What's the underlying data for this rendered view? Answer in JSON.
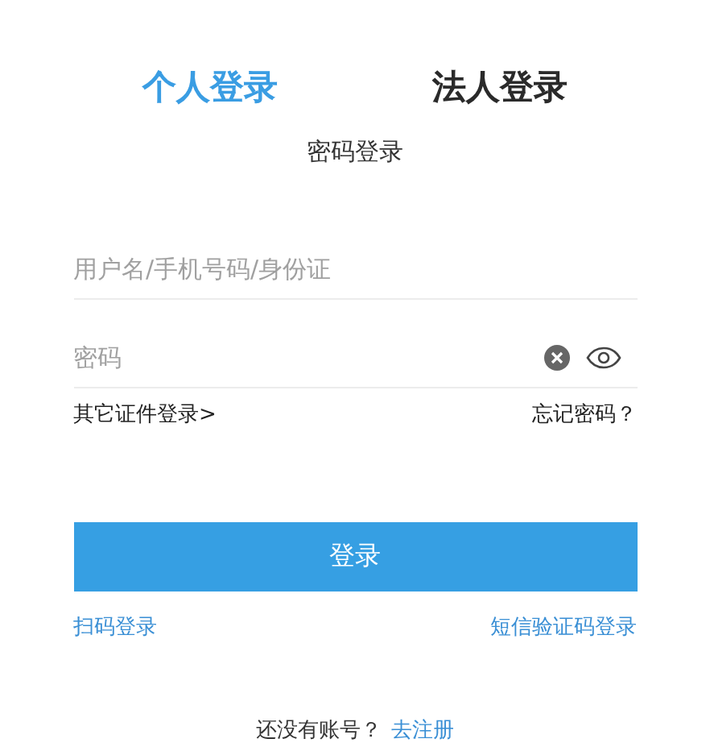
{
  "tabs": [
    {
      "label": "个人登录",
      "selected": true
    },
    {
      "label": "法人登录",
      "selected": false
    }
  ],
  "subtitle": "密码登录",
  "username": {
    "placeholder": "用户名/手机号码/身份证"
  },
  "password": {
    "placeholder": "密码"
  },
  "other_login": "其它证件登录>",
  "forgot": "忘记密码？",
  "login_button": "登录",
  "qr_login": "扫码登录",
  "sms_login": "短信验证码登录",
  "no_account": "还没有账号？",
  "register": "去注册"
}
